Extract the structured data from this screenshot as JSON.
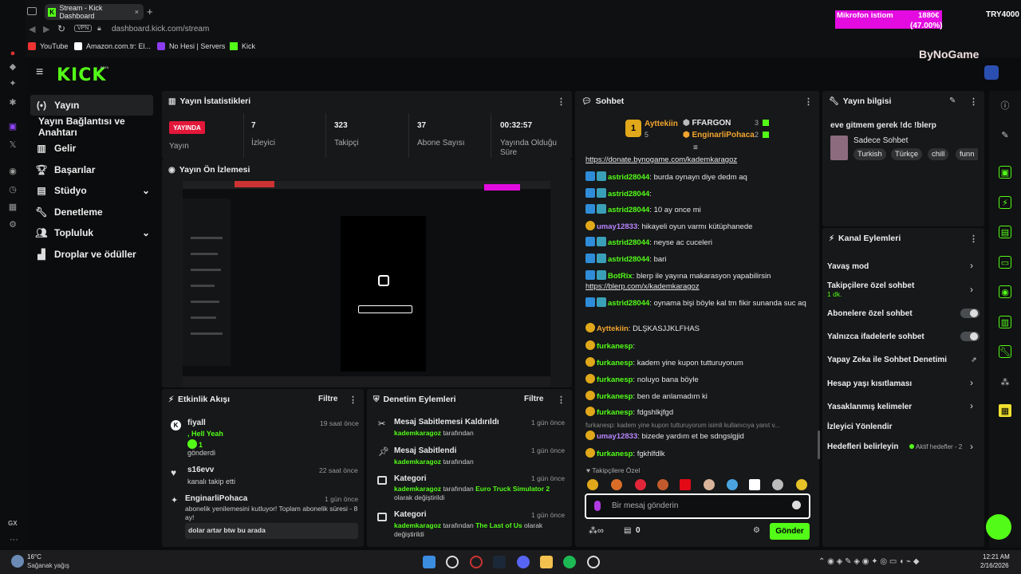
{
  "browser": {
    "tab_title": "Stream - Kick Dashboard",
    "url": "dashboard.kick.com/stream",
    "vpn": "VPN",
    "bookmarks": [
      "YouTube",
      "Amazon.com.tr: El...",
      "No Hesi | Servers",
      "Kick"
    ]
  },
  "overlay": {
    "label": "Mikrofon istiom",
    "value": "1880€",
    "pct": "(47.00%)",
    "goal": "TRY4000",
    "watermark": "ByNoGame"
  },
  "sidebar": {
    "logo": "KICK",
    "beta": "BETA",
    "items": [
      {
        "label": "Yayın",
        "icon": "stream-icon"
      },
      {
        "label": "Yayın Bağlantısı ve Anahtarı",
        "icon": ""
      },
      {
        "label": "Gelir",
        "icon": "revenue-icon"
      },
      {
        "label": "Başarılar",
        "icon": "trophy-icon"
      },
      {
        "label": "Stüdyo",
        "icon": "studio-icon"
      },
      {
        "label": "Denetleme",
        "icon": "wrench-icon"
      },
      {
        "label": "Topluluk",
        "icon": "community-icon"
      },
      {
        "label": "Droplar ve ödüller",
        "icon": "gift-icon"
      }
    ],
    "gx": "GX"
  },
  "stats": {
    "title": "Yayın İstatistikleri",
    "live": "YAYINDA",
    "live_lbl": "Yayın",
    "items": [
      {
        "v": "7",
        "l": "İzleyici"
      },
      {
        "v": "323",
        "l": "Takipçi"
      },
      {
        "v": "37",
        "l": "Abone Sayısı"
      },
      {
        "v": "00:32:57",
        "l": "Yayında Olduğu Süre"
      }
    ]
  },
  "preview": {
    "title": "Yayın Ön İzlemesi"
  },
  "activity": {
    "title": "Etkinlik Akışı",
    "filter": "Filtre",
    "items": [
      {
        "user": "fiyall",
        "time": "19 saat önce",
        "line1": ", Hell Yeah",
        "line2": "1",
        "line3": "gönderdi"
      },
      {
        "user": "s16evv",
        "time": "22 saat önce",
        "line1": "kanalı takip etti"
      },
      {
        "user": "EnginarliPohaca",
        "time": "1 gün önce",
        "line1": "abonelik yenilemesini kutluyor! Toplam abonelik süresi - 8 ay!",
        "msg": "dolar artar btw bu arada"
      }
    ]
  },
  "moderation": {
    "title": "Denetim Eylemleri",
    "filter": "Filtre",
    "items": [
      {
        "title": "Mesaj Sabitlemesi Kaldırıldı",
        "time": "1 gün önce",
        "by": "kademkaragoz",
        "suffix": "tarafından"
      },
      {
        "title": "Mesaj Sabitlendi",
        "time": "1 gün önce",
        "by": "kademkaragoz",
        "suffix": "tarafından"
      },
      {
        "title": "Kategori",
        "time": "1 gün önce",
        "by": "kademkaragoz",
        "mid": "tarafından",
        "cat": "Euro Truck Simulator 2",
        "suffix": "olarak değiştirildi"
      },
      {
        "title": "Kategori",
        "time": "1 gün önce",
        "by": "kademkaragoz",
        "mid": "tarafından",
        "cat": "The Last of Us",
        "suffix": "olarak değiştirildi"
      }
    ]
  },
  "chat": {
    "title": "Sohbet",
    "top": [
      {
        "name": "Ayttekiin",
        "n": "5"
      },
      {
        "name": "FFARGON",
        "n": "3"
      },
      {
        "name": "EnginarliPohaca",
        "n": "2"
      }
    ],
    "link_top": "https://donate.bynogame.com/kademkaragoz",
    "messages": [
      {
        "u": "astrid28044",
        "c": "green",
        "t": "burda oynayn diye dedm aq"
      },
      {
        "u": "astrid28044",
        "c": "green",
        "t": ""
      },
      {
        "u": "astrid28044",
        "c": "green",
        "t": "10 ay once mi"
      },
      {
        "u": "umay12833",
        "c": "purple",
        "t": "hikayeli oyun varmı kütüphanede"
      },
      {
        "u": "astrid28044",
        "c": "green",
        "t": "neyse ac cuceleri"
      },
      {
        "u": "astrid28044",
        "c": "green",
        "t": "bari"
      },
      {
        "u": "BotRix",
        "c": "green",
        "t": "blerp ile yayına makarasyon yapabilirsin",
        "link": "https://blerp.com/x/kademkaragoz"
      },
      {
        "u": "astrid28044",
        "c": "green",
        "t": "oynama bişi böyle kal tm fikir sunanda suc aq"
      },
      {
        "u": "Ayttekiin",
        "c": "orange",
        "t": "DLŞKASJJKLFHAS"
      },
      {
        "u": "furkanesp",
        "c": "green",
        "t": ""
      },
      {
        "u": "furkanesp",
        "c": "green",
        "t": "kadem yine kupon tutturuyorum"
      },
      {
        "u": "furkanesp",
        "c": "green",
        "t": "noluyo bana böyle"
      },
      {
        "u": "furkanesp",
        "c": "green",
        "t": "ben de anlamadım ki"
      },
      {
        "u": "furkanesp",
        "c": "green",
        "t": "fdgshlkjfgd"
      },
      {
        "reply": "furkanesp: kadem yine kupon tutturuyorum isimli kullanıcıya yanıt v...",
        "u": "umay12833",
        "c": "purple",
        "t": "bizede yardım et be sdngslgjid"
      },
      {
        "u": "furkanesp",
        "c": "green",
        "t": "fgkhlfdlk"
      }
    ],
    "followers_only": "Takipçilere Özel",
    "placeholder": "Bir mesaj gönderin",
    "points": "0",
    "send": "Gönder"
  },
  "info": {
    "title": "Yayın bilgisi",
    "stream_title": "eve gitmem gerek !dc !blerp",
    "category": "Sadece Sohbet",
    "tags": [
      "Turkish",
      "Türkçe",
      "chill",
      "funn"
    ]
  },
  "channel": {
    "title": "Kanal Eylemleri",
    "items": [
      {
        "label": "Yavaş mod"
      },
      {
        "label": "Takipçilere özel sohbet",
        "sub": "1 dk."
      },
      {
        "label": "Abonelere özel sohbet"
      },
      {
        "label": "Yalnızca ifadelerle sohbet"
      },
      {
        "label": "Yapay Zeka ile Sohbet Denetimi"
      },
      {
        "label": "Hesap yaşı kısıtlaması"
      },
      {
        "label": "Yasaklanmış kelimeler"
      },
      {
        "label": "İzleyici Yönlendir"
      },
      {
        "label": "Hedefleri belirleyin",
        "note": "Aktif hedefler - 2"
      }
    ]
  },
  "taskbar": {
    "temp": "16°C",
    "weather": "Sağanak yağış",
    "time": "12:21 AM",
    "date": "2/16/2026"
  }
}
